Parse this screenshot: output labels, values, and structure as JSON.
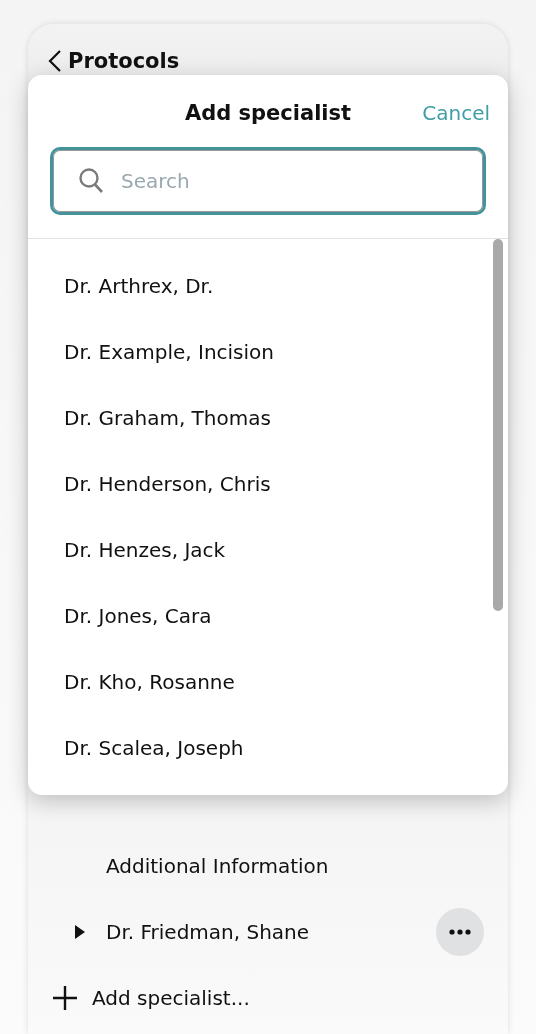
{
  "back": {
    "label": "Protocols"
  },
  "sheet": {
    "title": "Add specialist",
    "cancel": "Cancel",
    "search": {
      "placeholder": "Search"
    },
    "specialists": [
      "Dr. Arthrex, Dr.",
      "Dr. Example, Incision",
      "Dr. Graham, Thomas",
      "Dr. Henderson, Chris",
      "Dr. Henzes, Jack",
      "Dr. Jones, Cara",
      "Dr. Kho, Rosanne",
      "Dr. Scalea, Joseph"
    ]
  },
  "outline": [
    {
      "label": "Additional Information",
      "kind": "section"
    },
    {
      "label": "Dr. Friedman, Shane",
      "kind": "specialist",
      "expanded": false
    }
  ],
  "add_action": {
    "label": "Add specialist..."
  }
}
